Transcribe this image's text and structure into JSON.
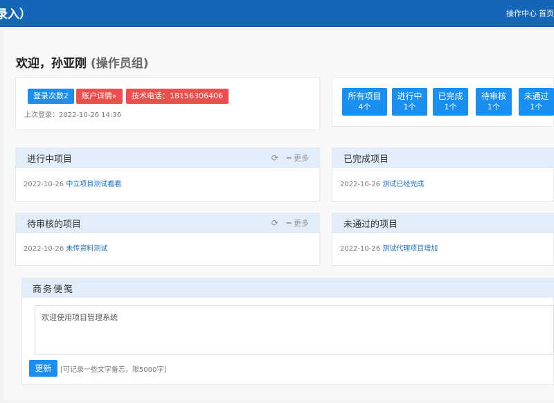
{
  "header": {
    "title": "录入）",
    "nav": [
      "操作中心",
      "首页"
    ]
  },
  "welcome": {
    "greeting": "欢迎，孙亚刚",
    "group": "(操作员组)"
  },
  "account": {
    "login_count": "登录次数2",
    "account_details": "账户详情»",
    "support_phone": "技术电话：18156306406",
    "last_login": "上次登录：2022-10-26 14:36"
  },
  "stats": [
    {
      "label": "所有项目",
      "count": "4个"
    },
    {
      "label": "进行中",
      "count": "1个"
    },
    {
      "label": "已完成",
      "count": "1个"
    },
    {
      "label": "待审核",
      "count": "1个"
    },
    {
      "label": "未通过",
      "count": "1个"
    }
  ],
  "more_label": "更多",
  "panels": {
    "in_progress": {
      "title": "进行中项目",
      "date": "2022-10-26",
      "link": "中立项目测试看看"
    },
    "completed": {
      "title": "已完成项目",
      "date": "2022-10-26",
      "link": "测试已经完成"
    },
    "pending": {
      "title": "待审核的项目",
      "date": "2022-10-26",
      "link": "未传资料测试"
    },
    "rejected": {
      "title": "未通过的项目",
      "date": "2022-10-26",
      "link": "测试代理项目增加"
    }
  },
  "memo": {
    "title": "商务便笺",
    "content": "欢迎使用项目管理系统",
    "button": "更新",
    "hint": "[可记录一些文字备忘，限5000字]"
  },
  "colors": {
    "header_bg": "#1565b8",
    "primary": "#1b8ff0",
    "danger": "#f04e4e",
    "panel_head": "#e2edfa",
    "link": "#1a6ec4"
  }
}
